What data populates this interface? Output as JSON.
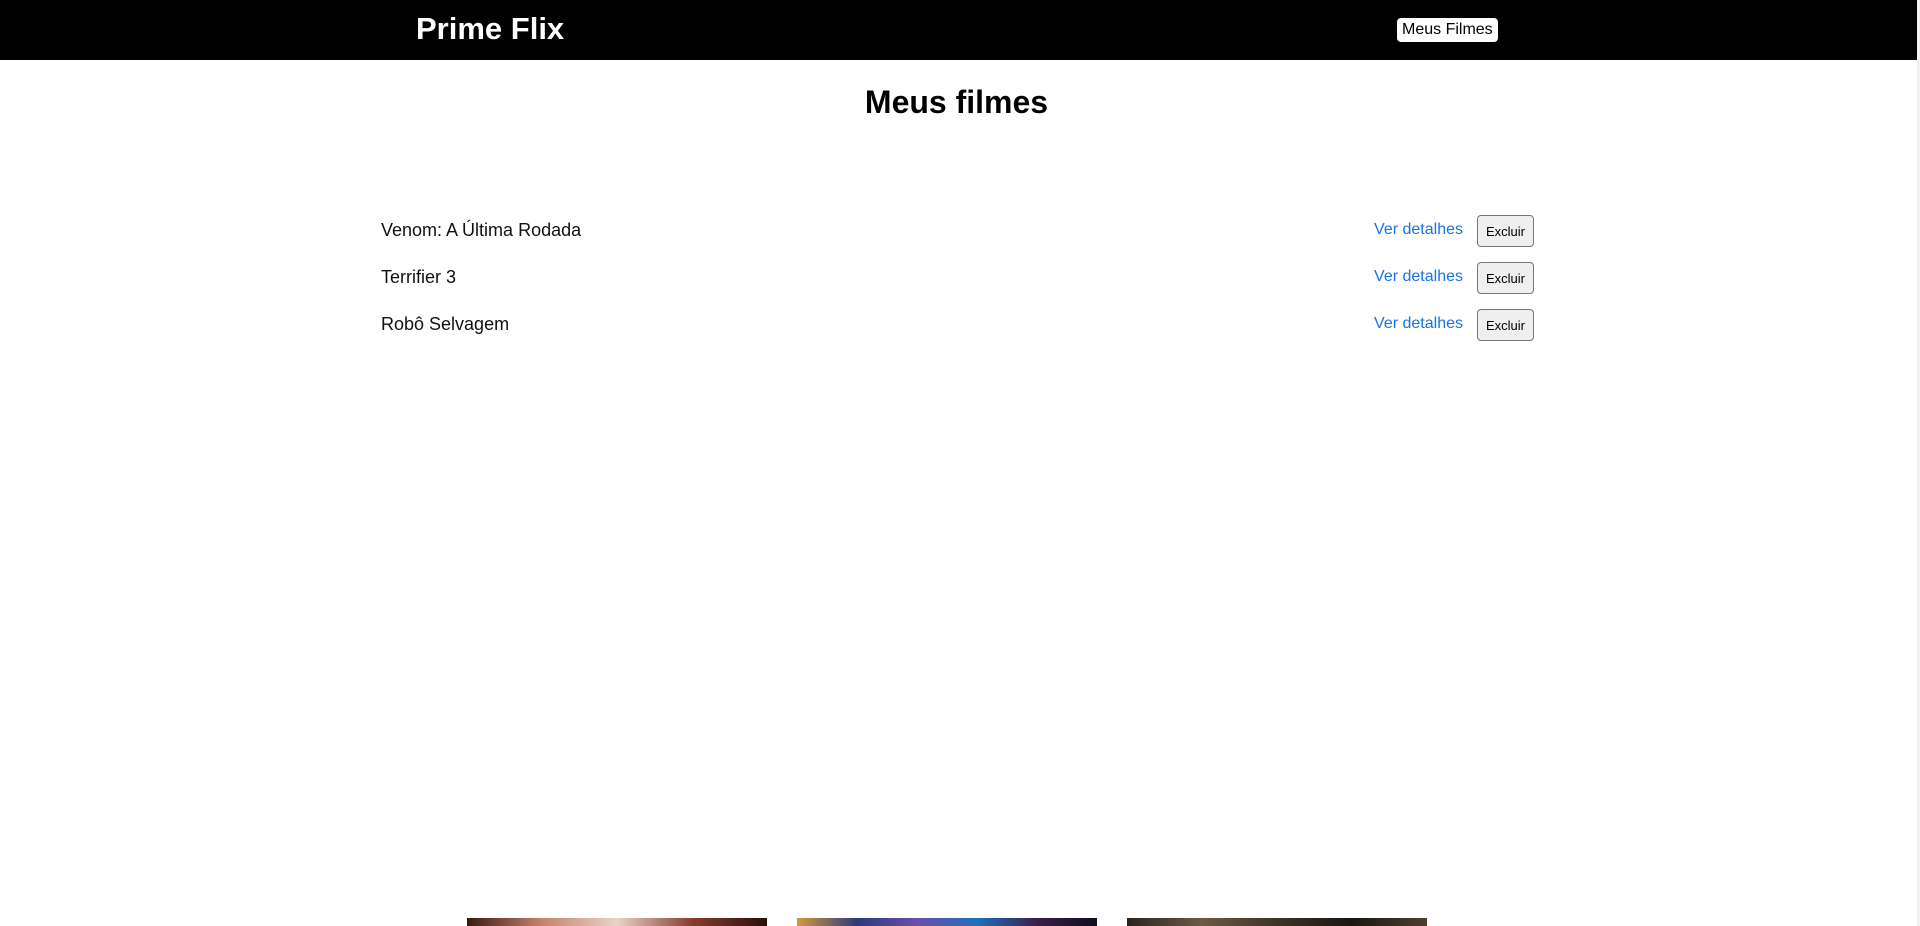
{
  "header": {
    "brand": "Prime Flix",
    "nav_button": "Meus Filmes"
  },
  "main": {
    "title": "Meus filmes",
    "movies": [
      {
        "title": "Venom: A Última Rodada",
        "details_label": "Ver detalhes",
        "delete_label": "Excluir"
      },
      {
        "title": "Terrifier 3",
        "details_label": "Ver detalhes",
        "delete_label": "Excluir"
      },
      {
        "title": "Robô Selvagem",
        "details_label": "Ver detalhes",
        "delete_label": "Excluir"
      }
    ]
  },
  "colors": {
    "header_bg": "#000000",
    "link": "#1a73e8",
    "button_bg": "#efefef"
  }
}
